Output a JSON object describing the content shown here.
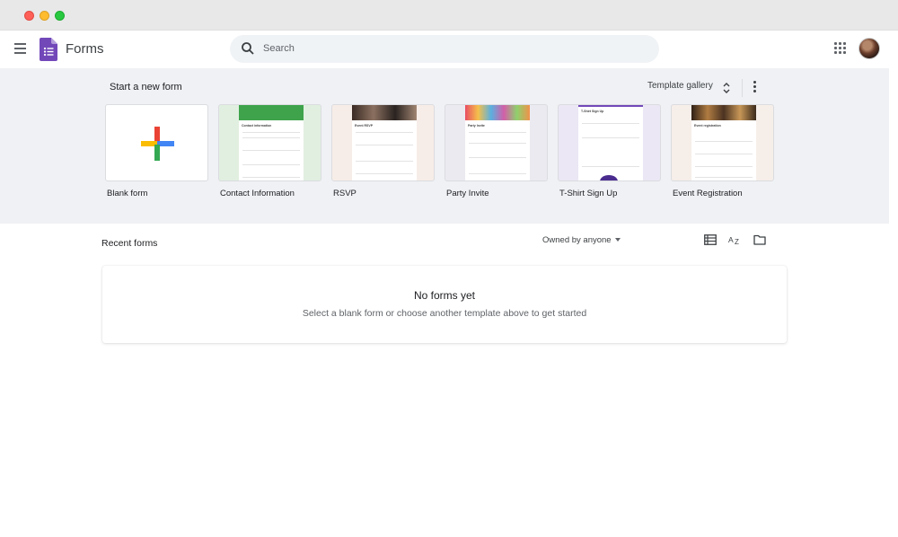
{
  "app": {
    "title": "Forms"
  },
  "search": {
    "placeholder": "Search"
  },
  "templates_section": {
    "heading": "Start a new form",
    "gallery_label": "Template gallery",
    "templates": [
      {
        "label": "Blank form"
      },
      {
        "label": "Contact Information",
        "form_title": "Contact information",
        "banner_color": "#3ea34b",
        "bg": "#e1efe0"
      },
      {
        "label": "RSVP",
        "form_title": "Event RSVP",
        "banner_color": "#6b5a4b",
        "bg": "#f7ede8"
      },
      {
        "label": "Party Invite",
        "form_title": "Party Invite",
        "banner_color": "#d49b45",
        "bg": "#eceaf1"
      },
      {
        "label": "T-Shirt Sign Up",
        "form_title": "T-Shirt Sign Up",
        "banner_color": "#7248b9",
        "bg": "#ebe7f4"
      },
      {
        "label": "Event Registration",
        "form_title": "Event registration",
        "banner_color": "#6d4a2a",
        "bg": "#f6eee9"
      }
    ]
  },
  "recent": {
    "title": "Recent forms",
    "owner_filter": "Owned by anyone",
    "empty_title": "No forms yet",
    "empty_subtitle": "Select a blank form or choose another template above to get started"
  },
  "colors": {
    "forms_purple": "#7248b9",
    "google_blue": "#4285f4",
    "google_red": "#ea4335",
    "google_yellow": "#fbbc04",
    "google_green": "#34a853"
  }
}
